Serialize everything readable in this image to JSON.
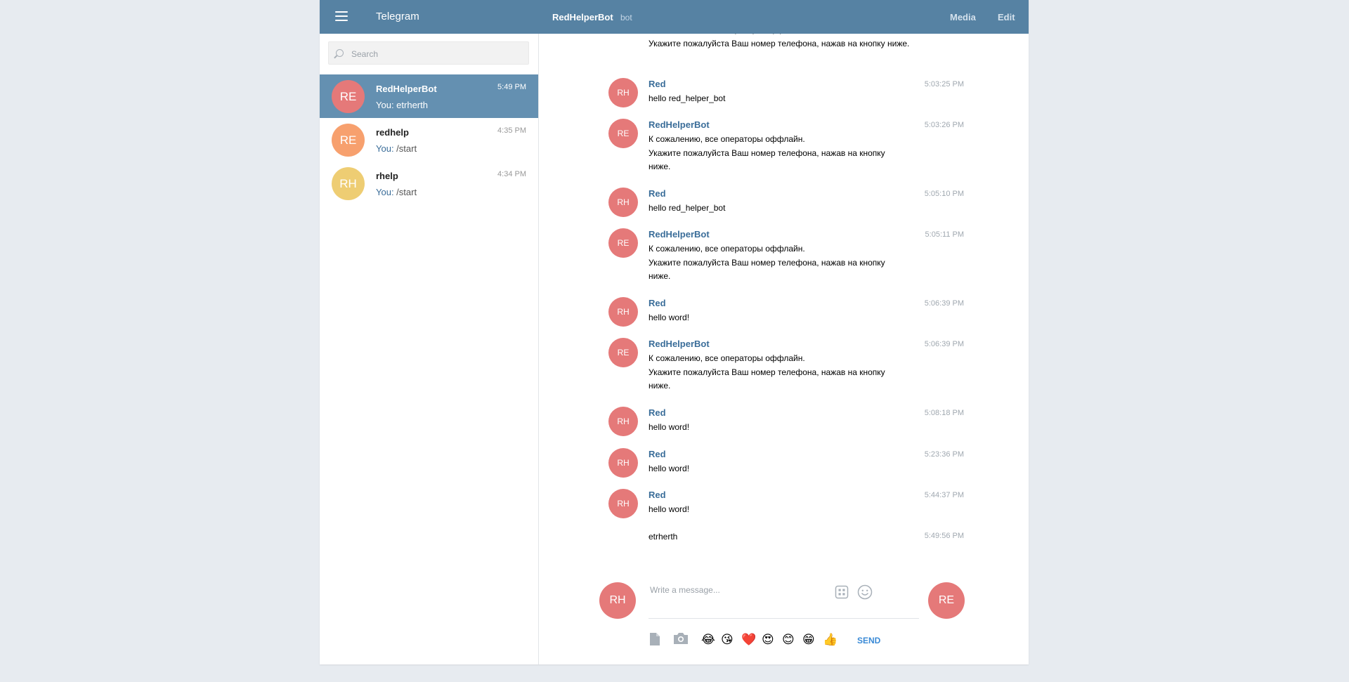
{
  "header": {
    "app_title": "Telegram",
    "peer_name": "RedHelperBot",
    "peer_status": "bot",
    "media_label": "Media",
    "edit_label": "Edit"
  },
  "search": {
    "placeholder": "Search"
  },
  "dialogs": [
    {
      "initials": "RE",
      "name": "RedHelperBot",
      "time": "5:49 PM",
      "preview_prefix": "You: ",
      "preview": "etrherth",
      "avatar_color": "#e57979",
      "active": true
    },
    {
      "initials": "RE",
      "name": "redhelp",
      "time": "4:35 PM",
      "preview_prefix": "You:",
      "preview": " /start",
      "avatar_color": "#f7a06e",
      "active": false
    },
    {
      "initials": "RH",
      "name": "rhelp",
      "time": "4:34 PM",
      "preview_prefix": "You:",
      "preview": " /start",
      "avatar_color": "#eecd73",
      "active": false
    }
  ],
  "messages": [
    {
      "text": "К сожалению, все операторы оффлайн.\nУкажите пожалуйста Ваш номер телефона, нажав на кнопку ниже."
    },
    {
      "initials": "RH",
      "author": "Red",
      "time": "5:03:25 PM",
      "text": "hello red_helper_bot"
    },
    {
      "initials": "RE",
      "author": "RedHelperBot",
      "time": "5:03:26 PM",
      "text": "К сожалению, все операторы оффлайн.\nУкажите пожалуйста Ваш номер телефона, нажав на кнопку\nниже."
    },
    {
      "initials": "RH",
      "author": "Red",
      "time": "5:05:10 PM",
      "text": "hello red_helper_bot"
    },
    {
      "initials": "RE",
      "author": "RedHelperBot",
      "time": "5:05:11 PM",
      "text": "К сожалению, все операторы оффлайн.\nУкажите пожалуйста Ваш номер телефона, нажав на кнопку\nниже."
    },
    {
      "initials": "RH",
      "author": "Red",
      "time": "5:06:39 PM",
      "text": "hello word!"
    },
    {
      "initials": "RE",
      "author": "RedHelperBot",
      "time": "5:06:39 PM",
      "text": "К сожалению, все операторы оффлайн.\nУкажите пожалуйста Ваш номер телефона, нажав на кнопку\nниже."
    },
    {
      "initials": "RH",
      "author": "Red",
      "time": "5:08:18 PM",
      "text": "hello word!"
    },
    {
      "initials": "RH",
      "author": "Red",
      "time": "5:23:36 PM",
      "text": "hello word!"
    },
    {
      "initials": "RH",
      "author": "Red",
      "time": "5:44:37 PM",
      "text": "hello word!"
    },
    {
      "time": "5:49:56 PM",
      "text": "etrherth"
    }
  ],
  "composer": {
    "placeholder": "Write a message...",
    "my_initials": "RH",
    "peer_initials": "RE",
    "send_label": "SEND",
    "emojis": [
      "😂",
      "😘",
      "❤️",
      "😍",
      "😊",
      "😁",
      "👍"
    ]
  },
  "colors": {
    "header": "#5682a3",
    "avatar_red": "#e57979",
    "avatar_orange": "#f7a06e",
    "avatar_yellow": "#eecd73",
    "link": "#3a6d99",
    "send": "#3a8ad6"
  }
}
